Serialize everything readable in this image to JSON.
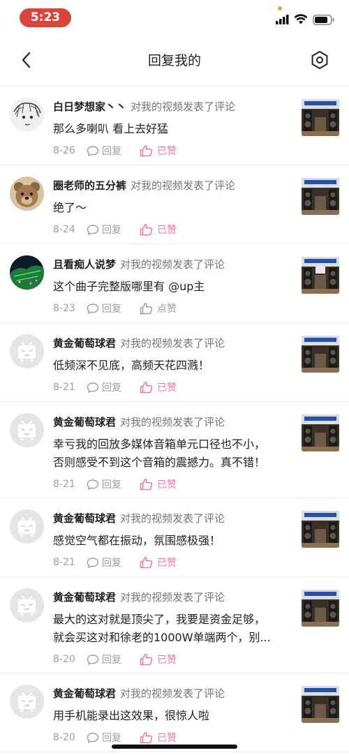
{
  "status_bar": {
    "time": "5:23"
  },
  "nav": {
    "title": "回复我的",
    "back_icon": "chevron-left-icon",
    "settings_icon": "hexagon-settings-icon"
  },
  "colors": {
    "accent": "#fb7299",
    "time_pill": "#d9453a",
    "meta": "#9e9e9e"
  },
  "comments": [
    {
      "user": "白日梦想家丶丶",
      "action": "对我的视频发表了评论",
      "lines": [
        "那么多喇叭 看上去好猛"
      ],
      "date": "8-26",
      "reply": "回复",
      "like": "已赞",
      "liked": true,
      "avatar": "sketch"
    },
    {
      "user": "圈老师的五分裤",
      "action": "对我的视频发表了评论",
      "lines": [
        "绝了～"
      ],
      "date": "8-24",
      "reply": "回复",
      "like": "已赞",
      "liked": true,
      "avatar": "bear"
    },
    {
      "user": "且看痴人说梦",
      "action": "对我的视频发表了评论",
      "lines": [
        "这个曲子完整版哪里有 @up主"
      ],
      "date": "8-23",
      "reply": "回复",
      "like": "点赞",
      "liked": false,
      "avatar": "night"
    },
    {
      "user": "黄金葡萄球君",
      "action": "对我的视频发表了评论",
      "lines": [
        "低频深不见底，高频天花四溅！"
      ],
      "date": "8-21",
      "reply": "回复",
      "like": "已赞",
      "liked": true,
      "avatar": "default"
    },
    {
      "user": "黄金葡萄球君",
      "action": "对我的视频发表了评论",
      "lines": [
        "幸亏我的回放多媒体音箱单元口径也不小，",
        "否则感受不到这个音箱的震撼力。真不错！"
      ],
      "date": "8-21",
      "reply": "回复",
      "like": "已赞",
      "liked": true,
      "avatar": "default"
    },
    {
      "user": "黄金葡萄球君",
      "action": "对我的视频发表了评论",
      "lines": [
        "感觉空气都在振动，氛围感极强！"
      ],
      "date": "8-21",
      "reply": "回复",
      "like": "已赞",
      "liked": true,
      "avatar": "default"
    },
    {
      "user": "黄金葡萄球君",
      "action": "对我的视频发表了评论",
      "lines": [
        "最大的这对就是顶尖了，我要是资金足够，",
        "就会买这对和徐老的1000W单端两个，别..."
      ],
      "date": "8-20",
      "reply": "回复",
      "like": "已赞",
      "liked": true,
      "avatar": "default"
    },
    {
      "user": "黄金葡萄球君",
      "action": "对我的视频发表了评论",
      "lines": [
        "用手机能录出这效果，很惊人啦"
      ],
      "date": "8-20",
      "reply": "回复",
      "like": "已赞",
      "liked": true,
      "avatar": "default"
    }
  ]
}
